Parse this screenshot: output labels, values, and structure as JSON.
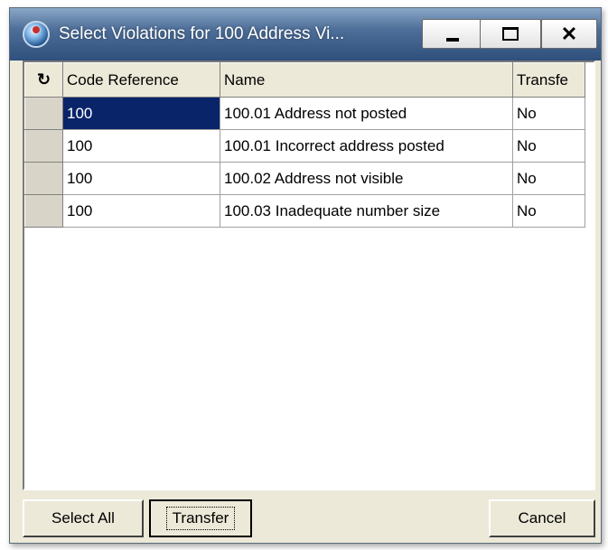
{
  "window": {
    "title": "Select Violations for 100  Address Vi..."
  },
  "grid": {
    "refresh_icon": "↻",
    "columns": [
      "Code Reference",
      "Name",
      "Transfe"
    ],
    "rows": [
      {
        "code": "100",
        "name": "100.01  Address not posted",
        "transfer": "No"
      },
      {
        "code": "100",
        "name": "100.01  Incorrect address posted",
        "transfer": "No"
      },
      {
        "code": "100",
        "name": "100.02  Address not visible",
        "transfer": "No"
      },
      {
        "code": "100",
        "name": "100.03  Inadequate number size",
        "transfer": "No"
      }
    ],
    "selected_cell_color": "#0a246a"
  },
  "buttons": {
    "select_all": "Select All",
    "transfer": "Transfer",
    "cancel": "Cancel"
  },
  "icons": {
    "app": "app-logo-icon",
    "refresh": "refresh-icon",
    "minimize": "minimize-icon",
    "maximize": "maximize-icon",
    "close": "close-icon"
  }
}
